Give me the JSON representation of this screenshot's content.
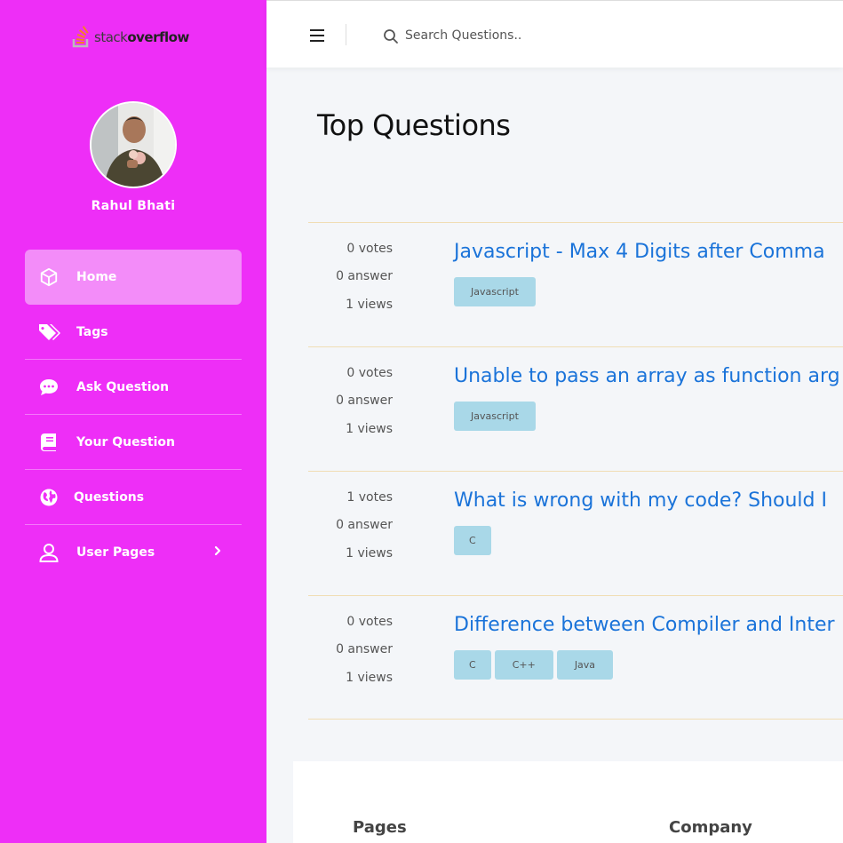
{
  "brand": {
    "part1": "stack",
    "part2": "overflow"
  },
  "user": {
    "name": "Rahul Bhati"
  },
  "sidebar": {
    "items": [
      {
        "label": "Home",
        "icon": "cube-icon"
      },
      {
        "label": "Tags",
        "icon": "tags-icon"
      },
      {
        "label": "Ask Question",
        "icon": "chat-bubble-icon"
      },
      {
        "label": "Your Question",
        "icon": "book-icon"
      },
      {
        "label": "Questions",
        "icon": "globe-icon"
      },
      {
        "label": "User Pages",
        "icon": "user-icon"
      }
    ]
  },
  "search": {
    "placeholder": "Search Questions.."
  },
  "main": {
    "title": "Top Questions",
    "questions": [
      {
        "votes": "0 votes",
        "answers": "0 answer",
        "views": "1 views",
        "title": "Javascript - Max 4 Digits after Comma",
        "tags": [
          "Javascript"
        ]
      },
      {
        "votes": "0 votes",
        "answers": "0 answer",
        "views": "1 views",
        "title": "Unable to pass an array as function arg",
        "tags": [
          "Javascript"
        ]
      },
      {
        "votes": "1 votes",
        "answers": "0 answer",
        "views": "1 views",
        "title": "What is wrong with my code? Should I",
        "tags": [
          "C"
        ]
      },
      {
        "votes": "0 votes",
        "answers": "0 answer",
        "views": "1 views",
        "title": "Difference between Compiler and Inter",
        "tags": [
          "C",
          "C++",
          "Java"
        ]
      }
    ]
  },
  "footer": {
    "col1": "Pages",
    "col2": "Company"
  },
  "colors": {
    "sidebar": "#ee2ef7",
    "active": "#f38cf9",
    "link": "#1a73d9",
    "tag": "#a9d8e8",
    "divider": "#f0ddb4"
  }
}
